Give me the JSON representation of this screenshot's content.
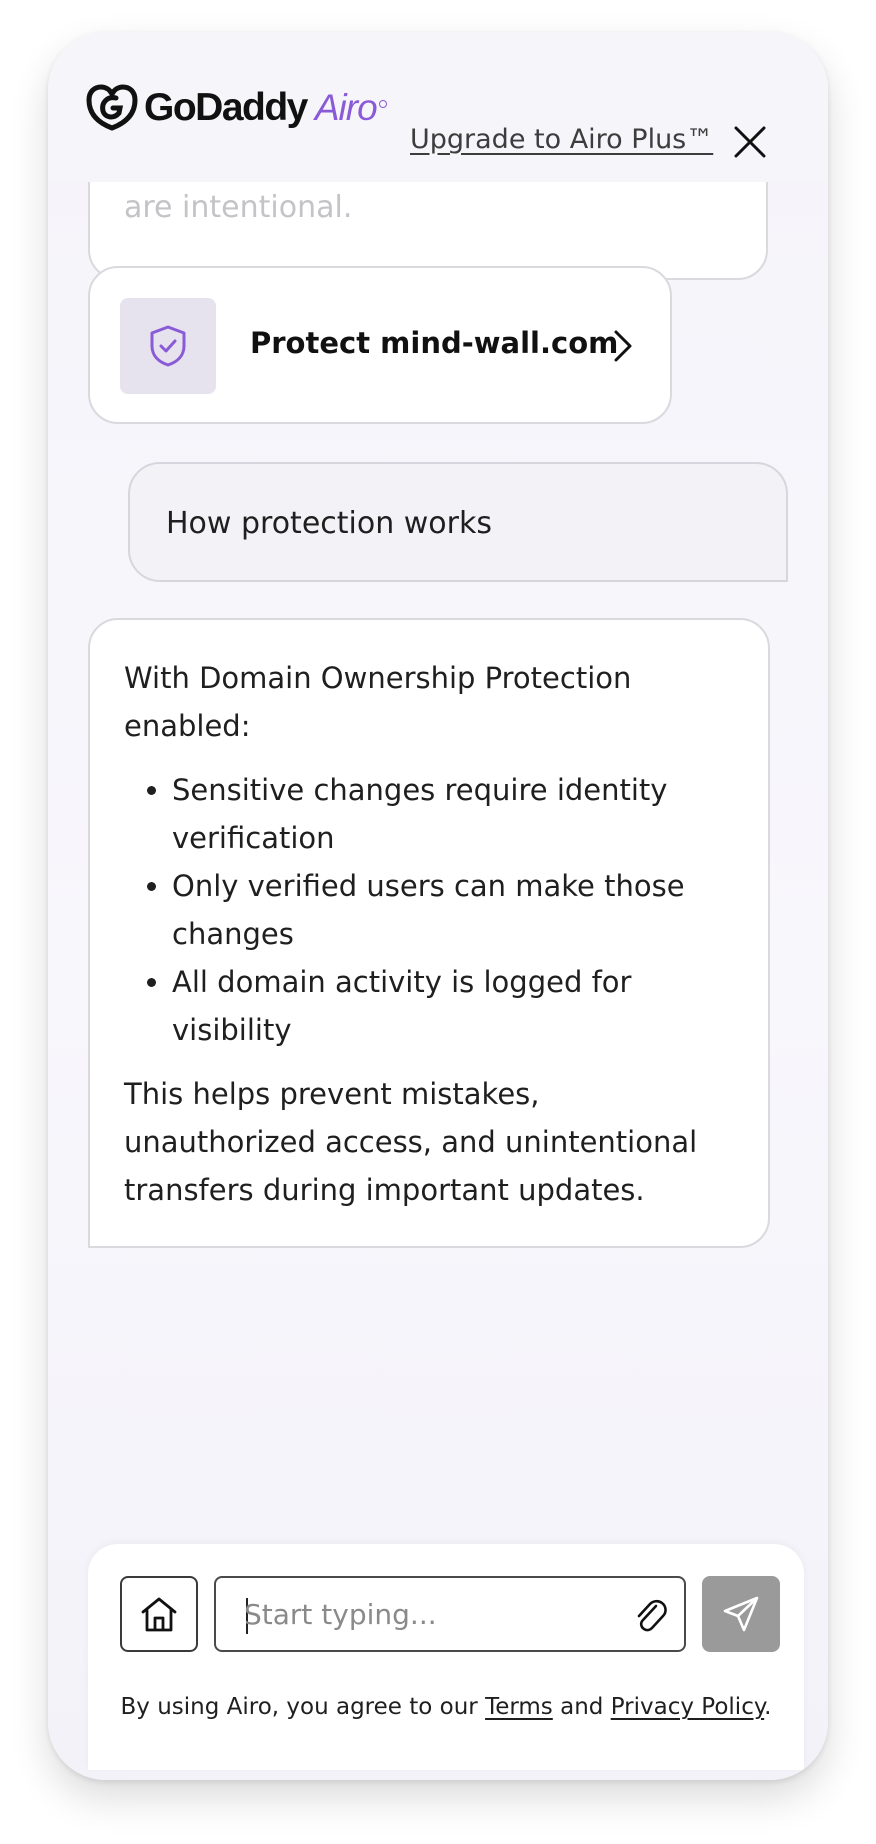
{
  "header": {
    "brand": "GoDaddy",
    "product": "Airo",
    "upgrade_link": "Upgrade to Airo Plus™",
    "close_icon": "close-icon"
  },
  "conversation": {
    "faded_text": "are intentional.",
    "action_card": {
      "label": "Protect mind-wall.com",
      "icon": "shield-check-icon",
      "chevron": "chevron-right-icon"
    },
    "user_message": "How protection works",
    "assistant_message": {
      "intro": "With Domain Ownership Protection enabled:",
      "bullets": [
        "Sensitive changes require identity verification",
        "Only verified users can make those changes",
        "All domain activity is logged for visibility"
      ],
      "outro": "This helps prevent mistakes, unauthorized access, and unintentional transfers during important updates."
    }
  },
  "composer": {
    "placeholder": "Start typing...",
    "home_icon": "home-icon",
    "attach_icon": "paperclip-icon",
    "send_icon": "send-icon"
  },
  "legal": {
    "prefix": "By using Airo, you agree to our ",
    "terms": "Terms",
    "and": " and ",
    "privacy": "Privacy Policy",
    "suffix": "."
  },
  "colors": {
    "accent": "#8a5bd6",
    "send_disabled": "#9a9a9a",
    "panel_bg": "#f6f5fa"
  }
}
